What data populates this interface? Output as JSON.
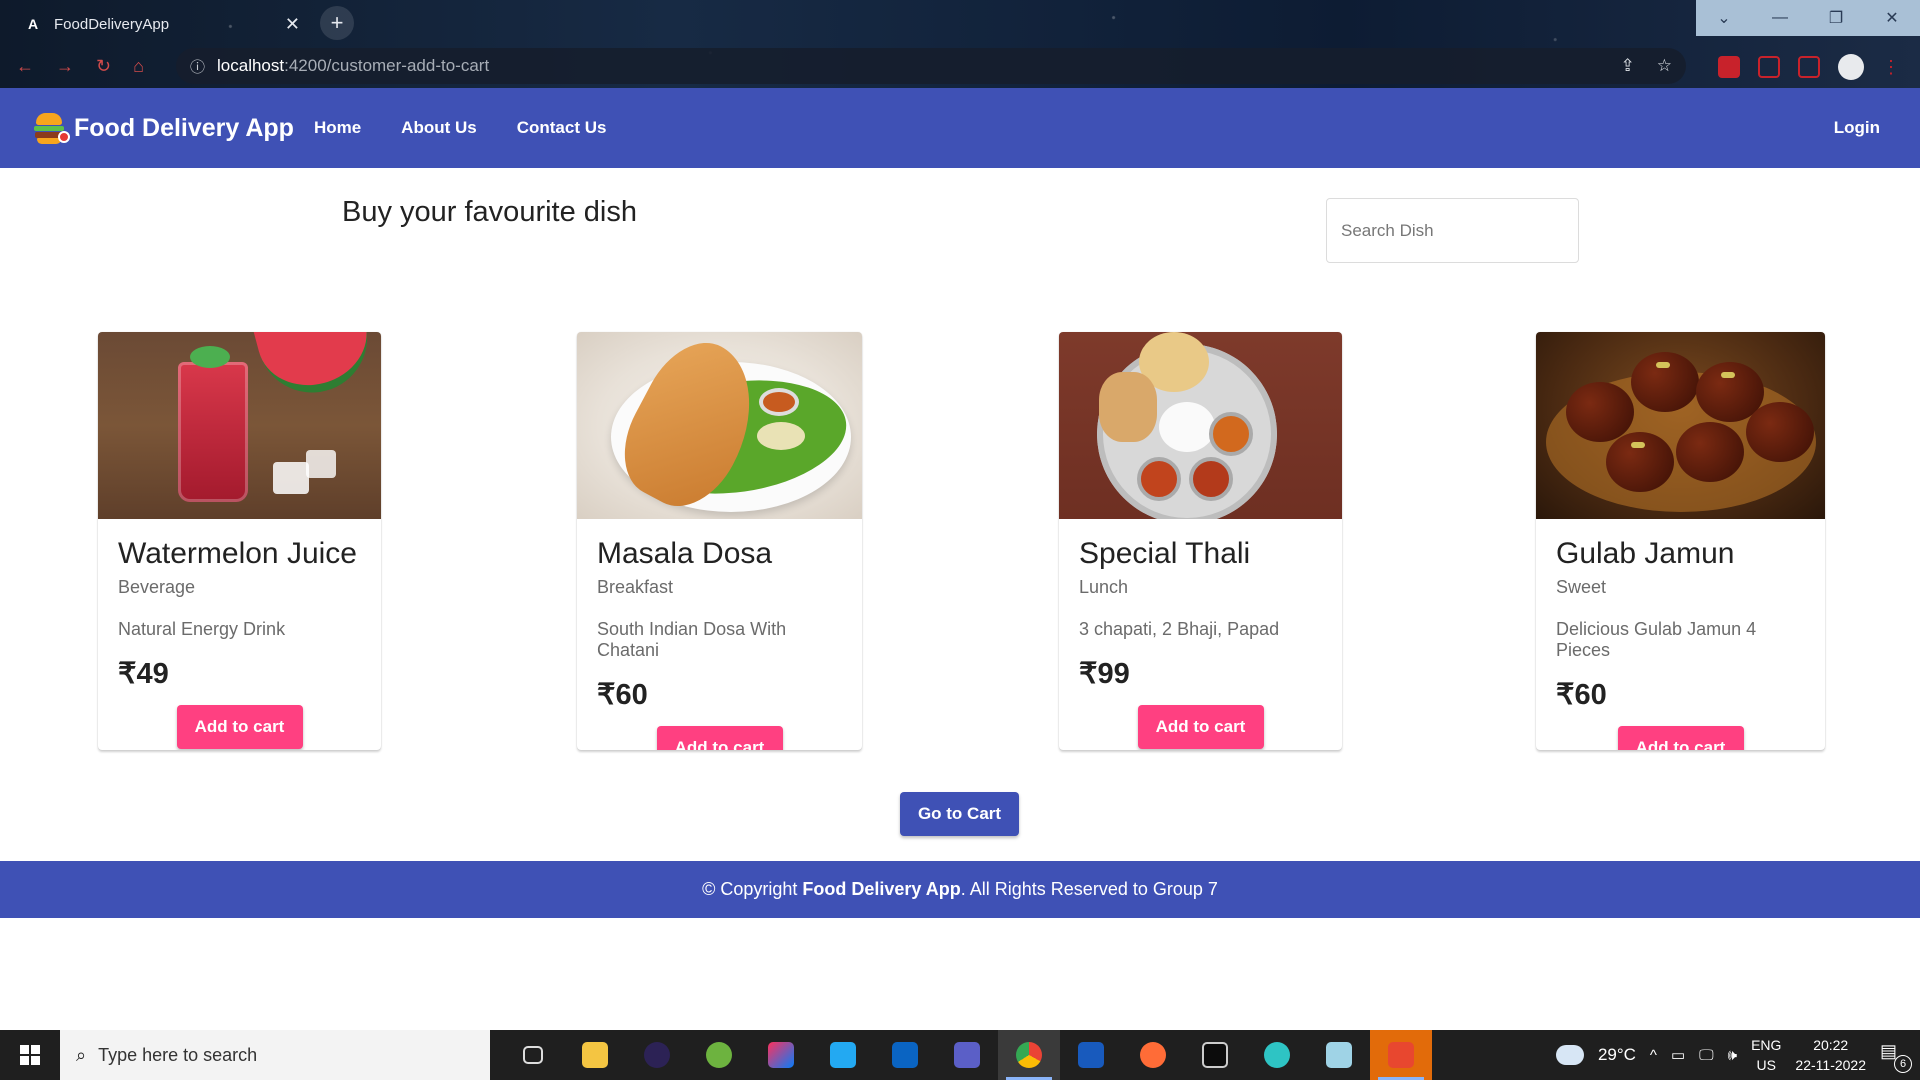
{
  "browser": {
    "tab_title": "FoodDeliveryApp",
    "tab_close": "✕",
    "new_tab": "+",
    "url_host": "localhost",
    "url_path": ":4200/customer-add-to-cart"
  },
  "header": {
    "brand": "Food Delivery App",
    "nav": [
      "Home",
      "About Us",
      "Contact Us"
    ],
    "login": "Login"
  },
  "main": {
    "title": "Buy your favourite dish",
    "search_placeholder": "Search Dish",
    "go_to_cart": "Go to Cart"
  },
  "dishes": [
    {
      "name": "Watermelon Juice",
      "category": "Beverage",
      "description": "Natural Energy Drink",
      "price": "₹49",
      "button": "Add to cart"
    },
    {
      "name": "Masala Dosa",
      "category": "Breakfast",
      "description": "South Indian Dosa With Chatani",
      "price": "₹60",
      "button": "Add to cart"
    },
    {
      "name": "Special Thali",
      "category": "Lunch",
      "description": "3 chapati, 2 Bhaji, Papad",
      "price": "₹99",
      "button": "Add to cart"
    },
    {
      "name": "Gulab Jamun",
      "category": "Sweet",
      "description": "Delicious Gulab Jamun 4 Pieces",
      "price": "₹60",
      "button": "Add to cart"
    }
  ],
  "footer": {
    "prefix": "© Copyright ",
    "brand": "Food Delivery App",
    "suffix": ". All Rights Reserved to Group 7"
  },
  "taskbar": {
    "search_placeholder": "Type here to search",
    "temperature": "29°C",
    "lang_line1": "ENG",
    "lang_line2": "US",
    "time": "20:22",
    "date": "22-11-2022",
    "notification_count": "6"
  },
  "colors": {
    "primary": "#3f51b5",
    "accent": "#ff4081"
  }
}
